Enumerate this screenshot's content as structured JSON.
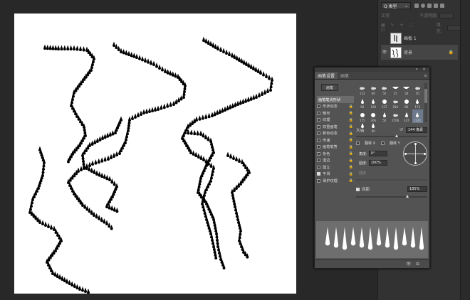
{
  "layers": {
    "kind_label": "Q 类型",
    "mode_label": "正常",
    "opacity_label": "不透明度:",
    "fill_label": "填充:",
    "items": [
      {
        "name": "画板 1",
        "visible": false
      },
      {
        "name": "背景",
        "visible": true
      }
    ]
  },
  "brush_panel": {
    "tabs": [
      "画笔设置",
      "画笔"
    ],
    "preset_button": "画笔",
    "options": [
      {
        "label": "画笔笔尖形状",
        "checked": null,
        "selected": true
      },
      {
        "label": "形状动态",
        "checked": false
      },
      {
        "label": "散布",
        "checked": false
      },
      {
        "label": "纹理",
        "checked": false
      },
      {
        "label": "双重画笔",
        "checked": false
      },
      {
        "label": "颜色动态",
        "checked": false
      },
      {
        "label": "传递",
        "checked": false
      },
      {
        "label": "画笔笔势",
        "checked": false
      },
      {
        "label": "杂色",
        "checked": false
      },
      {
        "label": "湿边",
        "checked": false
      },
      {
        "label": "建立",
        "checked": false
      },
      {
        "label": "平滑",
        "checked": true
      },
      {
        "label": "保护纹理",
        "checked": false
      }
    ],
    "tip_sizes": [
      "112",
      "60",
      "50",
      "25",
      "30",
      "50",
      "60",
      "100",
      "127",
      "284",
      "80",
      "174",
      "175",
      "306",
      "50",
      "2506",
      "337",
      "2341",
      "16",
      "80"
    ],
    "size_label": "大小",
    "size_value": "144 像素",
    "flip_x_label": "翻转 X",
    "flip_y_label": "翻转 Y",
    "angle_label": "角度:",
    "angle_value": "0°",
    "roundness_label": "圆度:",
    "roundness_value": "100%",
    "hardness_label": "硬度",
    "spacing_label": "间距",
    "spacing_value": "185%",
    "spacing_checked": true
  }
}
